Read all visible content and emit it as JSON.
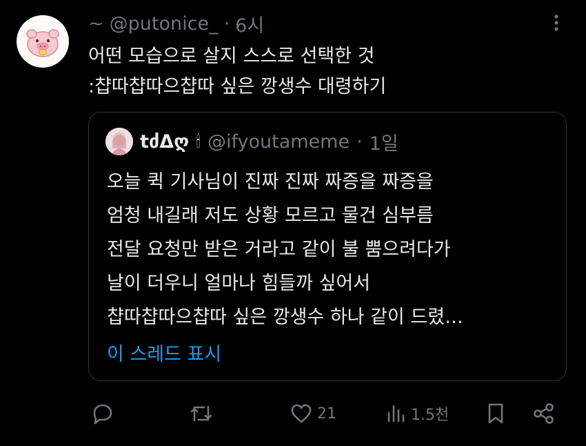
{
  "tweet": {
    "prefix": "~",
    "handle": "@putonice_",
    "separator": "·",
    "time": "6시",
    "text_lines": [
      "어떤 모습으로 살지 스스로 선택한 것",
      ":챱따챱따으챱따 싶은 깡생수 대령하기"
    ]
  },
  "quote": {
    "display_name": "tძΔღ",
    "emoji": "🕯",
    "handle": "@ifyoutameme",
    "separator": "·",
    "time": "1일",
    "text_lines": [
      "오늘 퀵 기사님이 진짜 진짜 짜증을 짜증을",
      "엄청 내길래 저도 상황 모르고 물건 심부름",
      "전달 요청만 받은 거라고 같이 불 뿜으려다가",
      "날이 더우니 얼마나 힘들까 싶어서",
      "챱따챱따으챱따 싶은 깡생수 하나 같이 드렸…"
    ],
    "show_thread": "이 스레드 표시"
  },
  "actions": {
    "likes": "21",
    "views": "1.5천"
  },
  "colors": {
    "background": "#000000",
    "text": "#e7e9ea",
    "muted": "#71767b",
    "link": "#1d9bf0",
    "border": "#2f3336"
  }
}
